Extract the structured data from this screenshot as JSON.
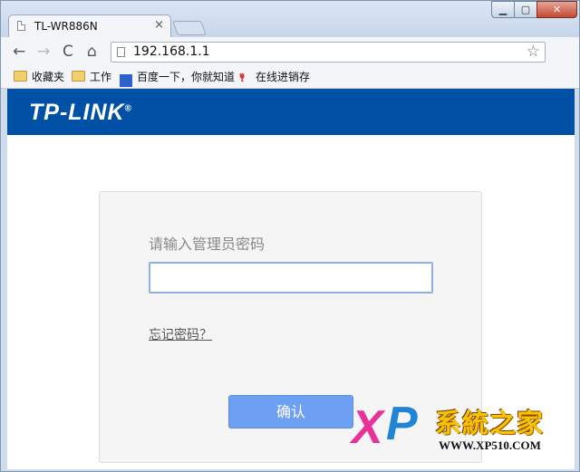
{
  "browser": {
    "tab_title": "TL-WR886N",
    "tab_close": "×",
    "window_controls": {
      "minimize": "▁",
      "maximize": "▢",
      "close": "✕"
    },
    "nav": {
      "back": "←",
      "forward": "→",
      "reload": "C",
      "home": "⌂"
    },
    "url": "192.168.1.1",
    "star": "☆",
    "bookmarks": [
      {
        "label": "收藏夹",
        "icon": "folder-icon"
      },
      {
        "label": "工作",
        "icon": "folder-icon"
      },
      {
        "label": "百度一下，你就知道",
        "icon": "baidu-paw-icon"
      },
      {
        "label": "在线进销存",
        "icon": "figure-icon"
      }
    ],
    "bookmark_icon_glyphs": {
      "paw": "🐾",
      "figure": "𐇳"
    }
  },
  "page": {
    "brand": "TP-LINK",
    "brand_mark": "®",
    "login": {
      "prompt": "请输入管理员密码",
      "password_value": "",
      "forgot_link": "忘记密码？",
      "confirm_label": "确认"
    },
    "colors": {
      "brand_bar": "#0051a5",
      "confirm_button": "#6d9ff3"
    }
  },
  "watermark": {
    "letter_x": "X",
    "letter_p": "P",
    "name": "系統之家",
    "url": "WWW.XP510.COM"
  }
}
